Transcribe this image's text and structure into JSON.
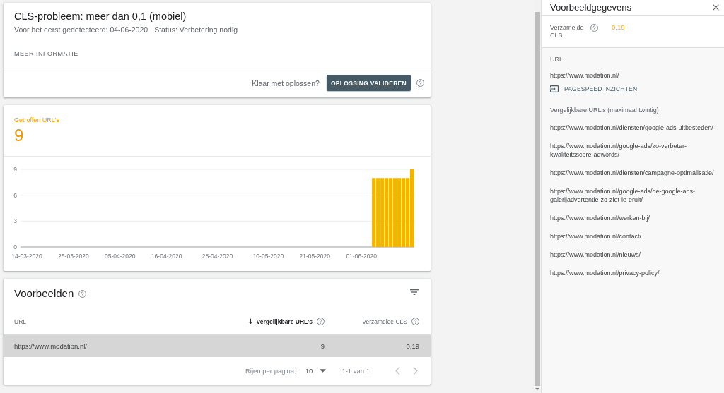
{
  "issue": {
    "title": "CLS-probleem: meer dan 0,1 (mobiel)",
    "first_detected": "Voor het eerst gedetecteerd: 04-06-2020",
    "status": "Status: Verbetering nodig",
    "more_info": "MEER INFORMATIE",
    "validate_prompt": "Klaar met oplossen?",
    "validate_button": "OPLOSSING VALIDEREN"
  },
  "affected": {
    "label": "Getroffen URL's",
    "count": "9",
    "chart_data": {
      "type": "bar",
      "categories": [
        "14-03-2020",
        null,
        null,
        null,
        null,
        null,
        null,
        null,
        null,
        null,
        null,
        "25-03-2020",
        null,
        null,
        null,
        null,
        null,
        null,
        null,
        null,
        null,
        null,
        "05-04-2020",
        null,
        null,
        null,
        null,
        null,
        null,
        null,
        null,
        null,
        null,
        "16-04-2020",
        null,
        null,
        null,
        null,
        null,
        null,
        null,
        null,
        null,
        null,
        null,
        "28-04-2020",
        null,
        null,
        null,
        null,
        null,
        null,
        null,
        null,
        null,
        null,
        null,
        "10-05-2020",
        null,
        null,
        null,
        null,
        null,
        null,
        null,
        null,
        null,
        null,
        "21-05-2020",
        null,
        null,
        null,
        null,
        null,
        null,
        null,
        null,
        null,
        null,
        "01-06-2020",
        null,
        null,
        null,
        null,
        null,
        null,
        null,
        null,
        null,
        null,
        null,
        null
      ],
      "values": [
        0,
        0,
        0,
        0,
        0,
        0,
        0,
        0,
        0,
        0,
        0,
        0,
        0,
        0,
        0,
        0,
        0,
        0,
        0,
        0,
        0,
        0,
        0,
        0,
        0,
        0,
        0,
        0,
        0,
        0,
        0,
        0,
        0,
        0,
        0,
        0,
        0,
        0,
        0,
        0,
        0,
        0,
        0,
        0,
        0,
        0,
        0,
        0,
        0,
        0,
        0,
        0,
        0,
        0,
        0,
        0,
        0,
        0,
        0,
        0,
        0,
        0,
        0,
        0,
        0,
        0,
        0,
        0,
        0,
        0,
        0,
        0,
        0,
        0,
        0,
        0,
        0,
        0,
        0,
        0,
        0,
        0,
        8,
        8,
        8,
        8,
        8,
        8,
        8,
        8,
        8,
        9
      ],
      "ylim": [
        0,
        9
      ],
      "yticks": [
        0,
        3,
        6,
        9
      ]
    }
  },
  "examples": {
    "title": "Voorbeelden",
    "columns": [
      {
        "label": "URL",
        "sorted": false,
        "help": false
      },
      {
        "label": "Vergelijkbare URL's",
        "sorted": true,
        "help": true
      },
      {
        "label": "Verzamelde CLS",
        "sorted": false,
        "help": true
      }
    ],
    "rows": [
      {
        "cells": [
          "https://www.modation.nl/",
          "9",
          "0,19"
        ],
        "selected": true
      }
    ],
    "pagination": {
      "rows_per_page_label": "Rijen per pagina:",
      "rows_per_page": "10",
      "range": "1-1 van 1",
      "buttons": [
        {
          "kind": "prev",
          "disabled": true
        },
        {
          "kind": "next",
          "disabled": true
        }
      ]
    }
  },
  "details_panel": {
    "title": "Voorbeeldgegevens",
    "metric_label": "Verzamelde CLS",
    "metric_value": "0,19",
    "url_label": "URL",
    "url": "https://www.modation.nl/",
    "pagespeed_link": "PAGESPEED INZICHTEN",
    "similar_label": "Vergelijkbare URL's (maximaal twintig)",
    "similar_urls": [
      "https://www.modation.nl/diensten/google-ads-uitbesteden/",
      "https://www.modation.nl/google-ads/zo-verbeter-kwaliteitsscore-adwords/",
      "https://www.modation.nl/diensten/campagne-optimalisatie/",
      "https://www.modation.nl/google-ads/de-google-ads-galerijadvertentie-zo-ziet-ie-eruit/",
      "https://www.modation.nl/werken-bij/",
      "https://www.modation.nl/contact/",
      "https://www.modation.nl/nieuws/",
      "https://www.modation.nl/privacy-policy/"
    ]
  }
}
